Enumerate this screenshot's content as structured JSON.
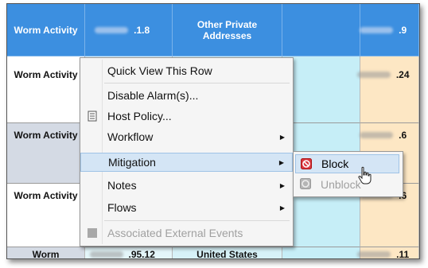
{
  "rows": [
    {
      "type": "Worm Activity",
      "ip_suffix": ".1.8",
      "location": "Other Private Addresses",
      "dest_suffix": ".9"
    },
    {
      "type": "Worm Activity",
      "ip_suffix": "",
      "location": "",
      "dest_suffix": ".24"
    },
    {
      "type": "Worm Activity",
      "ip_suffix": "",
      "location": "",
      "dest_suffix": ".6"
    },
    {
      "type": "Worm Activity",
      "ip_suffix": "",
      "location": "",
      "dest_suffix": ".6"
    },
    {
      "type": "Worm",
      "ip_suffix": ".95.12",
      "location": "United States",
      "dest_suffix": ".11"
    }
  ],
  "context_menu": {
    "items": [
      {
        "label": "Quick View This Row",
        "enabled": true
      },
      {
        "label": "Disable Alarm(s)...",
        "enabled": true
      },
      {
        "label": "Host Policy...",
        "icon": "document-icon",
        "enabled": true
      },
      {
        "label": "Workflow",
        "submenu": true,
        "enabled": true
      },
      {
        "label": "Mitigation",
        "submenu": true,
        "enabled": true,
        "highlighted": true
      },
      {
        "label": "Notes",
        "submenu": true,
        "enabled": true
      },
      {
        "label": "Flows",
        "submenu": true,
        "enabled": true
      },
      {
        "label": "Associated External Events",
        "icon": "external-events-icon",
        "enabled": false
      }
    ]
  },
  "mitigation_submenu": {
    "items": [
      {
        "label": "Block",
        "icon": "block-icon",
        "enabled": true,
        "highlighted": true
      },
      {
        "label": "Unblock",
        "icon": "unblock-icon",
        "enabled": false
      }
    ]
  },
  "colors": {
    "selected_row": "#3c8fe0",
    "menu_highlight": "#d4e5f5",
    "block_icon": "#d9363e"
  }
}
